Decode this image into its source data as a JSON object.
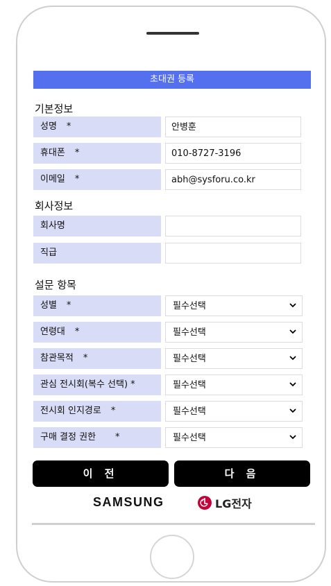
{
  "header": {
    "title": "초대권 등록"
  },
  "sections": {
    "basic": "기본정보",
    "company": "회사정보",
    "survey": "설문 항목"
  },
  "basic_fields": [
    {
      "label": "성명",
      "required": "*",
      "value": "안병훈"
    },
    {
      "label": "휴대폰",
      "required": "*",
      "value": "010-8727-3196"
    },
    {
      "label": "이메일",
      "required": "*",
      "value": "abh@sysforu.co.kr"
    }
  ],
  "company_fields": [
    {
      "label": "회사명",
      "value": ""
    },
    {
      "label": "직급",
      "value": ""
    }
  ],
  "survey_fields": [
    {
      "label": "성별",
      "required": "*",
      "selected": "필수선택"
    },
    {
      "label": "연령대",
      "required": "*",
      "selected": "필수선택"
    },
    {
      "label": "참관목적",
      "required": "*",
      "selected": "필수선택"
    },
    {
      "label": "관심 전시회(복수 선택)",
      "required": "*",
      "selected": "필수선택"
    },
    {
      "label": "전시회 인지경로",
      "required": "*",
      "selected": "필수선택"
    },
    {
      "label": "구매 결정 권한",
      "required": "*",
      "selected": "필수선택"
    }
  ],
  "buttons": {
    "prev": "이 전",
    "next": "다 음"
  },
  "brands": {
    "samsung": "SAMSUNG",
    "lg": "LG전자"
  },
  "colors": {
    "title_bar": "#5570ee",
    "label_bg": "#d9dcf6",
    "button_bg": "#000000",
    "lg_red": "#c4003b"
  }
}
